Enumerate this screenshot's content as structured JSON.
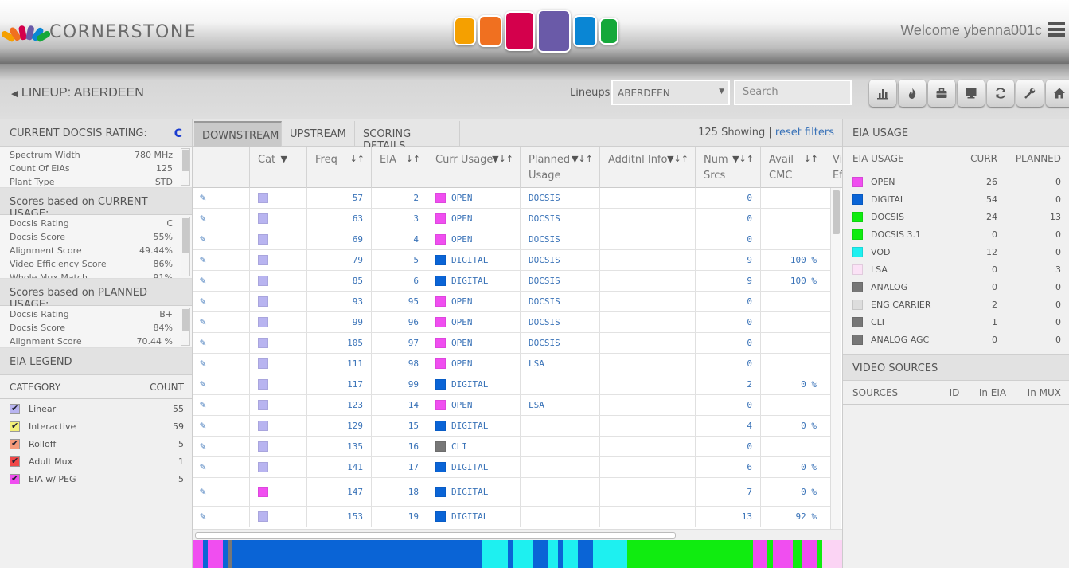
{
  "header": {
    "brand": "CORNERSTONE",
    "welcome": "Welcome ybenna001c",
    "tile_colors": [
      "#f5a000",
      "#f07020",
      "#d4004c",
      "#6a5aa8",
      "#0a86d4",
      "#15a83a"
    ]
  },
  "titlebar": {
    "title": "LINEUP: ABERDEEN",
    "lineups_label": "Lineups:",
    "lineup_selected": "ABERDEEN",
    "search_placeholder": "Search",
    "toolbar_icons": [
      "bar-chart-icon",
      "flame-icon",
      "briefcase-icon",
      "monitor-icon",
      "refresh-icon",
      "wrench-icon",
      "home-icon"
    ]
  },
  "left": {
    "docsis_head": "CURRENT DOCSIS RATING:",
    "docsis_rating": "C",
    "docsis_items": [
      {
        "k": "Spectrum Width",
        "v": "780 MHz"
      },
      {
        "k": "Count Of EIAs",
        "v": "125"
      },
      {
        "k": "Plant Type",
        "v": "STD"
      }
    ],
    "current_head": "Scores based on CURRENT USAGE:",
    "current_items": [
      {
        "k": "Docsis Rating",
        "v": "C"
      },
      {
        "k": "Docsis Score",
        "v": "55%"
      },
      {
        "k": "Alignment Score",
        "v": "49.44%"
      },
      {
        "k": "Video Efficiency Score",
        "v": "86%"
      },
      {
        "k": "Whole Mux Match",
        "v": "91%"
      }
    ],
    "planned_head": "Scores based on PLANNED USAGE:",
    "planned_items": [
      {
        "k": "Docsis Rating",
        "v": "B+"
      },
      {
        "k": "Docsis Score",
        "v": "84%"
      },
      {
        "k": "Alignment Score",
        "v": "70.44 %"
      }
    ],
    "legend_head": "EIA LEGEND",
    "legend_cols": {
      "category": "CATEGORY",
      "count": "COUNT"
    },
    "legend": [
      {
        "label": "Linear",
        "count": "55",
        "color": "#b8b4f0"
      },
      {
        "label": "Interactive",
        "count": "59",
        "color": "#f3f07a"
      },
      {
        "label": "Rolloff",
        "count": "5",
        "color": "#f59a7a"
      },
      {
        "label": "Adult Mux",
        "count": "1",
        "color": "#f04848"
      },
      {
        "label": "EIA w/ PEG",
        "count": "5",
        "color": "#f04ef0"
      }
    ]
  },
  "center": {
    "tabs": [
      "DOWNSTREAM",
      "UPSTREAM",
      "SCORING DETAILS"
    ],
    "showing": "125 Showing |",
    "reset": "reset filters",
    "columns": [
      "Cat",
      "Freq",
      "EIA",
      "Curr Usage",
      "Planned Usage",
      "Additnl Info",
      "Num Srcs",
      "Avail CMC",
      "Vi Ef"
    ],
    "rows": [
      {
        "cat": "#b8b4f0",
        "freq": "57",
        "eia": "2",
        "usage": "OPEN",
        "ucolor": "#f04ef0",
        "planned": "DOCSIS",
        "srcs": "0",
        "cmc": ""
      },
      {
        "cat": "#b8b4f0",
        "freq": "63",
        "eia": "3",
        "usage": "OPEN",
        "ucolor": "#f04ef0",
        "planned": "DOCSIS",
        "srcs": "0",
        "cmc": ""
      },
      {
        "cat": "#b8b4f0",
        "freq": "69",
        "eia": "4",
        "usage": "OPEN",
        "ucolor": "#f04ef0",
        "planned": "DOCSIS",
        "srcs": "0",
        "cmc": ""
      },
      {
        "cat": "#b8b4f0",
        "freq": "79",
        "eia": "5",
        "usage": "DIGITAL",
        "ucolor": "#0a64d6",
        "planned": "DOCSIS",
        "srcs": "9",
        "cmc": "100 %"
      },
      {
        "cat": "#b8b4f0",
        "freq": "85",
        "eia": "6",
        "usage": "DIGITAL",
        "ucolor": "#0a64d6",
        "planned": "DOCSIS",
        "srcs": "9",
        "cmc": "100 %"
      },
      {
        "cat": "#b8b4f0",
        "freq": "93",
        "eia": "95",
        "usage": "OPEN",
        "ucolor": "#f04ef0",
        "planned": "DOCSIS",
        "srcs": "0",
        "cmc": ""
      },
      {
        "cat": "#b8b4f0",
        "freq": "99",
        "eia": "96",
        "usage": "OPEN",
        "ucolor": "#f04ef0",
        "planned": "DOCSIS",
        "srcs": "0",
        "cmc": ""
      },
      {
        "cat": "#b8b4f0",
        "freq": "105",
        "eia": "97",
        "usage": "OPEN",
        "ucolor": "#f04ef0",
        "planned": "DOCSIS",
        "srcs": "0",
        "cmc": ""
      },
      {
        "cat": "#b8b4f0",
        "freq": "111",
        "eia": "98",
        "usage": "OPEN",
        "ucolor": "#f04ef0",
        "planned": "LSA",
        "srcs": "0",
        "cmc": ""
      },
      {
        "cat": "#b8b4f0",
        "freq": "117",
        "eia": "99",
        "usage": "DIGITAL",
        "ucolor": "#0a64d6",
        "planned": "",
        "srcs": "2",
        "cmc": "0 %"
      },
      {
        "cat": "#b8b4f0",
        "freq": "123",
        "eia": "14",
        "usage": "OPEN",
        "ucolor": "#f04ef0",
        "planned": "LSA",
        "srcs": "0",
        "cmc": ""
      },
      {
        "cat": "#b8b4f0",
        "freq": "129",
        "eia": "15",
        "usage": "DIGITAL",
        "ucolor": "#0a64d6",
        "planned": "",
        "srcs": "4",
        "cmc": "0 %"
      },
      {
        "cat": "#b8b4f0",
        "freq": "135",
        "eia": "16",
        "usage": "CLI",
        "ucolor": "#777777",
        "planned": "",
        "srcs": "0",
        "cmc": ""
      },
      {
        "cat": "#b8b4f0",
        "freq": "141",
        "eia": "17",
        "usage": "DIGITAL",
        "ucolor": "#0a64d6",
        "planned": "",
        "srcs": "6",
        "cmc": "0 %"
      },
      {
        "cat": "#f04ef0",
        "freq": "147",
        "eia": "18",
        "usage": "DIGITAL",
        "ucolor": "#0a64d6",
        "planned": "",
        "srcs": "7",
        "cmc": "0 %"
      },
      {
        "cat": "#b8b4f0",
        "freq": "153",
        "eia": "19",
        "usage": "DIGITAL",
        "ucolor": "#0a64d6",
        "planned": "",
        "srcs": "13",
        "cmc": "92 %"
      }
    ],
    "spectrum": [
      "#f04ef0",
      "#f04ef0",
      "#0a64d6",
      "#f04ef0",
      "#f04ef0",
      "#f04ef0",
      "#0a64d6",
      "#777777",
      "#0a64d6",
      "#0a64d6",
      "#0a64d6",
      "#0a64d6",
      "#0a64d6",
      "#0a64d6",
      "#0a64d6",
      "#0a64d6",
      "#0a64d6",
      "#0a64d6",
      "#0a64d6",
      "#0a64d6",
      "#0a64d6",
      "#0a64d6",
      "#0a64d6",
      "#0a64d6",
      "#0a64d6",
      "#0a64d6",
      "#0a64d6",
      "#0a64d6",
      "#0a64d6",
      "#0a64d6",
      "#0a64d6",
      "#0a64d6",
      "#0a64d6",
      "#0a64d6",
      "#0a64d6",
      "#0a64d6",
      "#0a64d6",
      "#0a64d6",
      "#0a64d6",
      "#0a64d6",
      "#0a64d6",
      "#0a64d6",
      "#0a64d6",
      "#0a64d6",
      "#0a64d6",
      "#0a64d6",
      "#0a64d6",
      "#0a64d6",
      "#0a64d6",
      "#0a64d6",
      "#0a64d6",
      "#0a64d6",
      "#0a64d6",
      "#0a64d6",
      "#0a64d6",
      "#0a64d6",
      "#0a64d6",
      "#0a64d6",
      "#1ef0f0",
      "#1ef0f0",
      "#1ef0f0",
      "#1ef0f0",
      "#1ef0f0",
      "#0a64d6",
      "#1ef0f0",
      "#1ef0f0",
      "#1ef0f0",
      "#1ef0f0",
      "#0a64d6",
      "#0a64d6",
      "#0a64d6",
      "#1ef0f0",
      "#1ef0f0",
      "#0a64d6",
      "#1ef0f0",
      "#1ef0f0",
      "#1ef0f0",
      "#0a64d6",
      "#0a64d6",
      "#0a64d6",
      "#1ef0f0",
      "#1ef0f0",
      "#1ef0f0",
      "#1ef0f0",
      "#1ef0f0",
      "#1ef0f0",
      "#1ef0f0",
      "#10ec10",
      "#10ec10",
      "#10ec10",
      "#10ec10",
      "#10ec10",
      "#10ec10",
      "#10ec10",
      "#10ec10",
      "#10ec10",
      "#10ec10",
      "#10ec10",
      "#10ec10",
      "#10ec10",
      "#10ec10",
      "#10ec10",
      "#10ec10",
      "#10ec10",
      "#10ec10",
      "#10ec10",
      "#10ec10",
      "#10ec10",
      "#10ec10",
      "#10ec10",
      "#10ec10",
      "#10ec10",
      "#f04ef0",
      "#f04ef0",
      "#f04ef0",
      "#10ec10",
      "#f04ef0",
      "#f04ef0",
      "#f04ef0",
      "#f04ef0",
      "#10ec10",
      "#10ec10",
      "#f04ef0",
      "#f04ef0",
      "#f04ef0",
      "#10ec10",
      "#fbd4f4",
      "#fbd4f4",
      "#fbd4f4",
      "#fbd4f4"
    ]
  },
  "right": {
    "usage_head": "EIA USAGE",
    "usage_cols": {
      "name": "EIA USAGE",
      "curr": "CURR",
      "planned": "PLANNED"
    },
    "usage": [
      {
        "name": "OPEN",
        "curr": "26",
        "planned": "0",
        "color": "#f04ef0"
      },
      {
        "name": "DIGITAL",
        "curr": "54",
        "planned": "0",
        "color": "#0a64d6"
      },
      {
        "name": "DOCSIS",
        "curr": "24",
        "planned": "13",
        "color": "#10ec10"
      },
      {
        "name": "DOCSIS 3.1",
        "curr": "0",
        "planned": "0",
        "color": "#10ec10"
      },
      {
        "name": "VOD",
        "curr": "12",
        "planned": "0",
        "color": "#1ef0f0"
      },
      {
        "name": "LSA",
        "curr": "0",
        "planned": "3",
        "color": "#fbe2f6"
      },
      {
        "name": "ANALOG",
        "curr": "0",
        "planned": "0",
        "color": "#777777"
      },
      {
        "name": "ENG CARRIER",
        "curr": "2",
        "planned": "0",
        "color": "#dddddd"
      },
      {
        "name": "CLI",
        "curr": "1",
        "planned": "0",
        "color": "#777777"
      },
      {
        "name": "ANALOG AGC",
        "curr": "0",
        "planned": "0",
        "color": "#777777"
      }
    ],
    "sources_head": "VIDEO SOURCES",
    "sources_cols": [
      "SOURCES",
      "ID",
      "In EIA",
      "In MUX"
    ]
  }
}
